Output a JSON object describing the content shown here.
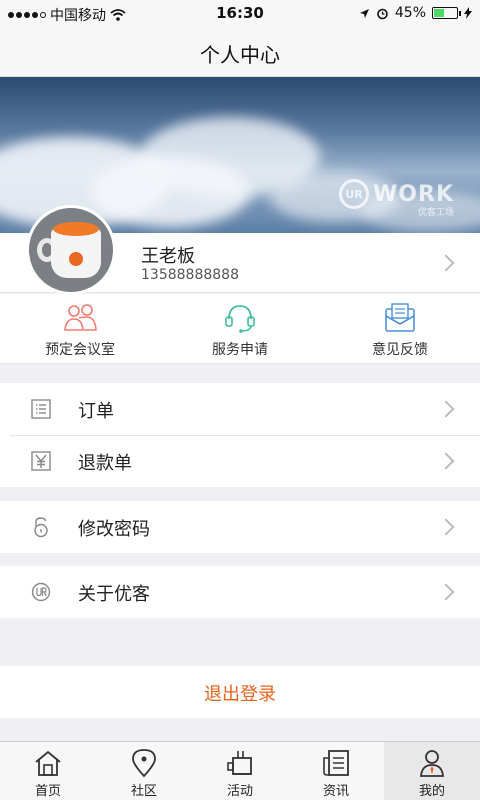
{
  "status_bar": {
    "carrier": "中国移动",
    "time": "16:30",
    "battery": "45%",
    "battery_level": 0.45
  },
  "header": {
    "title": "个人中心"
  },
  "banner": {
    "brand": "WORK",
    "brand_badge": "UR",
    "brand_sub": "优客工场"
  },
  "profile": {
    "name": "王老板",
    "phone": "13588888888"
  },
  "quick_actions": [
    {
      "label": "预定会议室",
      "icon": "people-icon",
      "color": "#f07b6e"
    },
    {
      "label": "服务申请",
      "icon": "headset-icon",
      "color": "#3fbf9f"
    },
    {
      "label": "意见反馈",
      "icon": "mail-icon",
      "color": "#4a90d9"
    }
  ],
  "menu": {
    "orders": "订单",
    "refunds": "退款单",
    "change_password": "修改密码",
    "about": "关于优客"
  },
  "logout": {
    "label": "退出登录",
    "color": "#e8631a"
  },
  "tabs": [
    {
      "label": "首页",
      "icon": "home-icon"
    },
    {
      "label": "社区",
      "icon": "location-icon"
    },
    {
      "label": "活动",
      "icon": "activity-icon"
    },
    {
      "label": "资讯",
      "icon": "news-icon"
    },
    {
      "label": "我的",
      "icon": "profile-icon",
      "active": true
    }
  ]
}
